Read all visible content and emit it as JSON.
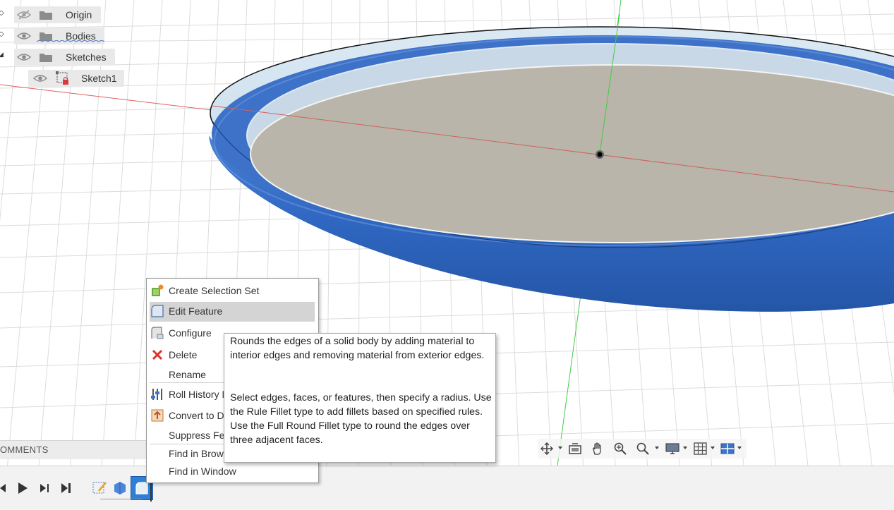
{
  "browser": {
    "items": [
      {
        "label": "Origin",
        "expand": "collapsed",
        "visibility": "hidden-eye-icon"
      },
      {
        "label": "Bodies",
        "expand": "collapsed",
        "visibility": "eye-icon"
      },
      {
        "label": "Sketches",
        "expand": "expanded",
        "visibility": "eye-icon"
      },
      {
        "label": "Sketch1",
        "expand": "none",
        "visibility": "eye-icon"
      }
    ]
  },
  "comments": {
    "label": "OMMENTS"
  },
  "context_menu": {
    "items": [
      {
        "label": "Create Selection Set",
        "icon": "selection-set-icon"
      },
      {
        "label": "Edit Feature",
        "icon": "fillet-icon",
        "highlighted": true
      },
      {
        "label": "Configure",
        "icon": "configure-icon"
      },
      {
        "label": "Delete",
        "icon": "delete-x-icon"
      },
      {
        "label": "Rename",
        "icon": ""
      },
      {
        "label": "Roll History M",
        "icon": "roll-history-icon"
      },
      {
        "label": "Convert to DI",
        "icon": "convert-icon"
      },
      {
        "label": "Suppress Fe",
        "icon": ""
      },
      {
        "label": "Find in Brows",
        "icon": ""
      },
      {
        "label": "Find in Window",
        "icon": ""
      }
    ]
  },
  "tooltip": {
    "paragraph1": "Rounds the edges of a solid body by adding material to interior edges and removing material from exterior edges.",
    "paragraph2": "Select edges, faces, or features, then specify a radius. Use the Rule Fillet type to add fillets based on specified rules. Use the Full Round Fillet type to round the edges over three adjacent faces."
  },
  "timeline": {
    "controls": [
      "step-back-icon",
      "play-icon",
      "step-forward-icon",
      "go-to-end-icon"
    ],
    "features": [
      "sketch-feature-icon",
      "extrude-feature-icon",
      "fillet-feature-icon"
    ]
  },
  "nav_toolbar": {
    "tools": [
      "orbit-icon",
      "look-at-icon",
      "pan-icon",
      "zoom-icon",
      "zoom-window-icon",
      "display-settings-icon",
      "grid-settings-icon",
      "viewports-icon"
    ]
  },
  "colors": {
    "body_blue": "#3a6fc4",
    "face_gray": "#b9b5aa",
    "x_axis": "#e06060",
    "y_axis": "#44cc44",
    "menu_highlight": "#d4d4d4"
  }
}
